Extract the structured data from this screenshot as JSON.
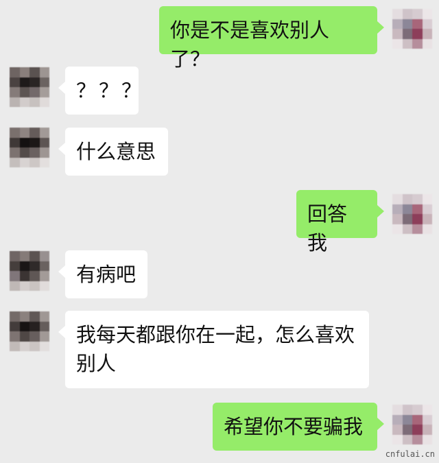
{
  "colors": {
    "background": "#ebebeb",
    "self_bubble": "#95ec69",
    "other_bubble": "#ffffff"
  },
  "messages": [
    {
      "side": "right",
      "text": "你是不是喜欢别人了？"
    },
    {
      "side": "left",
      "text": "？？？"
    },
    {
      "side": "left",
      "text": "什么意思"
    },
    {
      "side": "right",
      "text": "回答我"
    },
    {
      "side": "left",
      "text": "有病吧"
    },
    {
      "side": "left",
      "text": "我每天都跟你在一起，怎么喜欢别人"
    },
    {
      "side": "right",
      "text": "希望你不要骗我"
    }
  ],
  "watermark": "cnfulai.cn"
}
